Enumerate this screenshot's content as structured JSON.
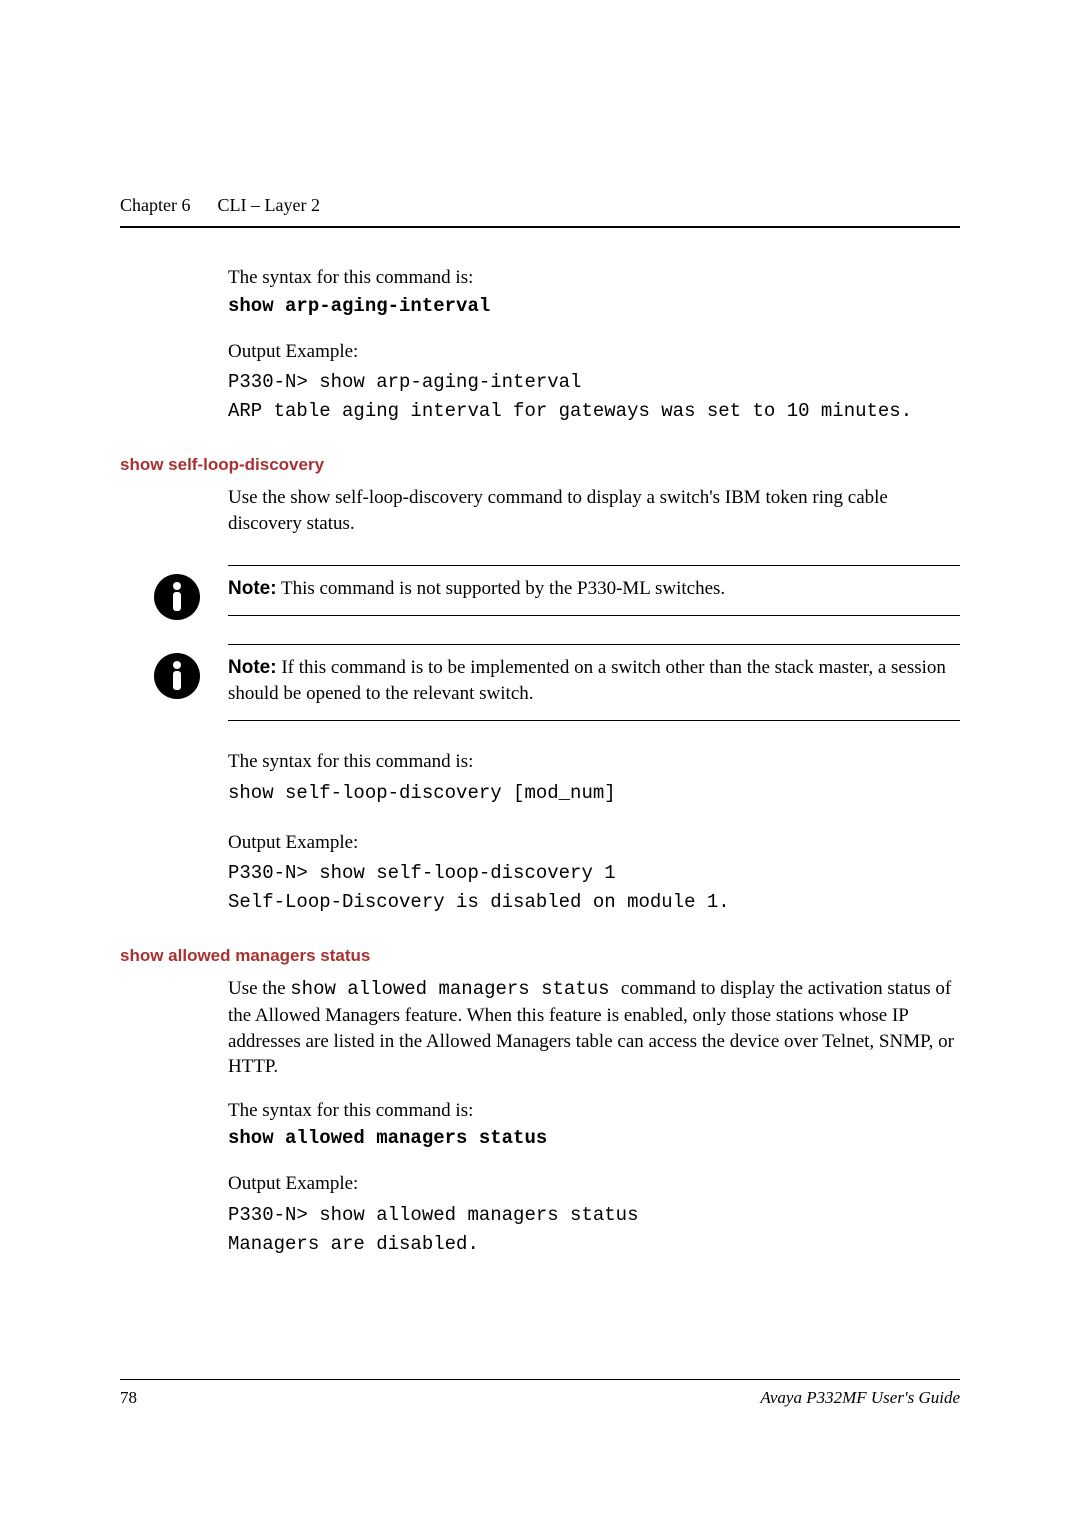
{
  "runningHead": {
    "chapter": "Chapter 6",
    "title": "CLI – Layer 2"
  },
  "section_arp": {
    "syntax_intro": "The syntax for this command is:",
    "syntax_cmd": "show arp-aging-interval",
    "output_label": "Output Example:",
    "output_line1": "P330-N> show arp-aging-interval",
    "output_line2": "ARP table aging interval for gateways was set to 10 minutes."
  },
  "selfloop": {
    "heading": "show self-loop-discovery",
    "intro": "Use the show self-loop-discovery command to display a switch's IBM token ring cable discovery status.",
    "note1_label": "Note:",
    "note1_text": "  This command is not supported by the P330-ML switches.",
    "note2_label": "Note:",
    "note2_text": "  If this command is to be implemented on a switch other than the stack master, a session should be opened to the relevant switch.",
    "syntax_intro": "The syntax for this command is:",
    "syntax_cmd": "show self-loop-discovery [mod_num]",
    "output_label": "Output Example:",
    "output_line1": "P330-N> show self-loop-discovery 1",
    "output_line2": "Self-Loop-Discovery is disabled on module 1."
  },
  "allowed": {
    "heading": "show allowed managers status",
    "intro_prefix": "Use the ",
    "intro_cmd": "show allowed managers status ",
    "intro_suffix": " command to display the activation status of the Allowed Managers feature. When this feature is enabled, only those stations whose IP addresses are listed in the Allowed Managers table can access the device over Telnet, SNMP, or HTTP.",
    "syntax_intro": "The syntax for this command is:",
    "syntax_cmd": "show allowed managers status",
    "output_label": "Output Example:",
    "output_line1": "P330-N> show allowed managers status",
    "output_line2": "Managers are disabled."
  },
  "footer": {
    "pageNumber": "78",
    "docTitle": "Avaya P332MF User's Guide"
  }
}
